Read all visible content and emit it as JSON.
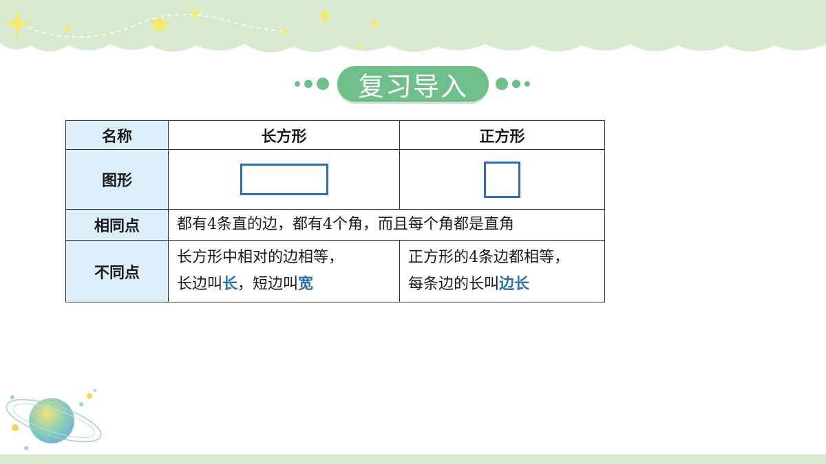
{
  "title": "复习导入",
  "table": {
    "header": {
      "name": "名称",
      "rect": "长方形",
      "square": "正方形"
    },
    "rows": {
      "figure": {
        "label": "图形"
      },
      "same": {
        "label": "相同点",
        "text": "都有4条直的边，都有4个角，而且每个角都是直角"
      },
      "diff": {
        "label": "不同点",
        "rect_line1": "长方形中相对的边相等，",
        "rect_line2_a": "长边叫",
        "rect_line2_hl1": "长",
        "rect_line2_b": "，短边叫",
        "rect_line2_hl2": "宽",
        "square_line1": "正方形的4条边都相等，",
        "square_line2_a": "每条边的长叫",
        "square_line2_hl": "边长"
      }
    }
  },
  "colors": {
    "accent_green": "#6fbf8a",
    "header_blue": "#dceef8",
    "shape_blue": "#2d6fb0"
  }
}
